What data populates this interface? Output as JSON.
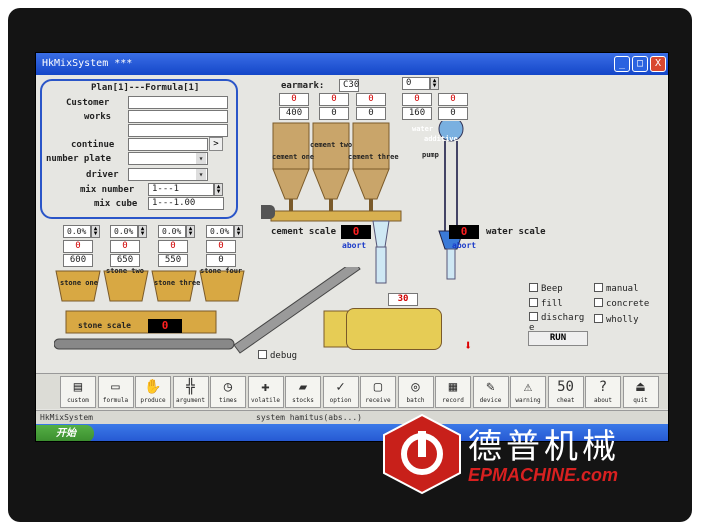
{
  "window": {
    "title": "HkMixSystem ***",
    "minimize": "_",
    "maximize": "□",
    "close": "X"
  },
  "form": {
    "header": "Plan[1]---Formula[1]",
    "customer_label": "Customer",
    "works_label": "works",
    "continue_label": "continue",
    "continue_btn": ">",
    "number_plate_label": "number plate",
    "driver_label": "driver",
    "mix_number_label": "mix number",
    "mix_number_value": "1---1",
    "mix_cube_label": "mix cube",
    "mix_cube_value": "1---1.00"
  },
  "cement": {
    "earmark_label": "earmark:",
    "earmark_value": "C30",
    "top_value": "0",
    "red_values": [
      "0",
      "0",
      "0",
      "0",
      "0"
    ],
    "set_values": [
      "400",
      "0",
      "0",
      "160",
      "0"
    ],
    "silo_labels": [
      "cement one",
      "cement two",
      "cement three"
    ],
    "water_labels": [
      "water",
      "additive"
    ],
    "pump_label": "pump",
    "cement_scale_label": "cement scale",
    "cement_scale_value": "0",
    "abort_left": "abort",
    "water_scale_label": "water scale",
    "water_scale_value": "0",
    "abort_right": "abort"
  },
  "stones": {
    "percents": [
      "0.0%",
      "0.0%",
      "0.0%",
      "0.0%"
    ],
    "red_values": [
      "0",
      "0",
      "0",
      "0"
    ],
    "set_values": [
      "600",
      "650",
      "550",
      "0"
    ],
    "bin_labels": [
      "stone one",
      "stone two",
      "stone three",
      "stone four"
    ],
    "stone_scale_label": "stone scale",
    "stone_scale_value": "0"
  },
  "mixer": {
    "value": "30",
    "debug_label": "debug"
  },
  "controls": {
    "beep": "Beep",
    "manual": "manual",
    "fill": "fill",
    "concrete": "concrete",
    "discharge": "discharg e",
    "wholly": "wholly",
    "run": "RUN"
  },
  "toolbar": [
    {
      "label": "custom",
      "icon": "book-icon",
      "glyph": "▤"
    },
    {
      "label": "formula",
      "icon": "card-icon",
      "glyph": "▭"
    },
    {
      "label": "produce",
      "icon": "hands-icon",
      "glyph": "✋"
    },
    {
      "label": "argument",
      "icon": "grid-icon",
      "glyph": "╬"
    },
    {
      "label": "times",
      "icon": "clock-icon",
      "glyph": "◷"
    },
    {
      "label": "volatile",
      "icon": "plus-icon",
      "glyph": "✚"
    },
    {
      "label": "stocks",
      "icon": "eraser-icon",
      "glyph": "▰"
    },
    {
      "label": "option",
      "icon": "check-icon",
      "glyph": "✓"
    },
    {
      "label": "receive",
      "icon": "doc-icon",
      "glyph": "▢"
    },
    {
      "label": "batch",
      "icon": "disc-icon",
      "glyph": "◎"
    },
    {
      "label": "record",
      "icon": "keyboard-icon",
      "glyph": "▦"
    },
    {
      "label": "device",
      "icon": "wrench-icon",
      "glyph": "✎"
    },
    {
      "label": "warning",
      "icon": "warning-icon",
      "glyph": "⚠"
    },
    {
      "label": "cheat",
      "icon": "calc-icon",
      "glyph": "50"
    },
    {
      "label": "about",
      "icon": "help-icon",
      "glyph": "?"
    },
    {
      "label": "quit",
      "icon": "exit-icon",
      "glyph": "⏏"
    }
  ],
  "statusbar": {
    "app": "HkMixSystem",
    "info": "system hamitus(abs...)"
  },
  "taskbar": {
    "start": "开始"
  },
  "watermark": {
    "brand_cn": "德普机械",
    "brand_en": "EPMACHINE.com"
  }
}
